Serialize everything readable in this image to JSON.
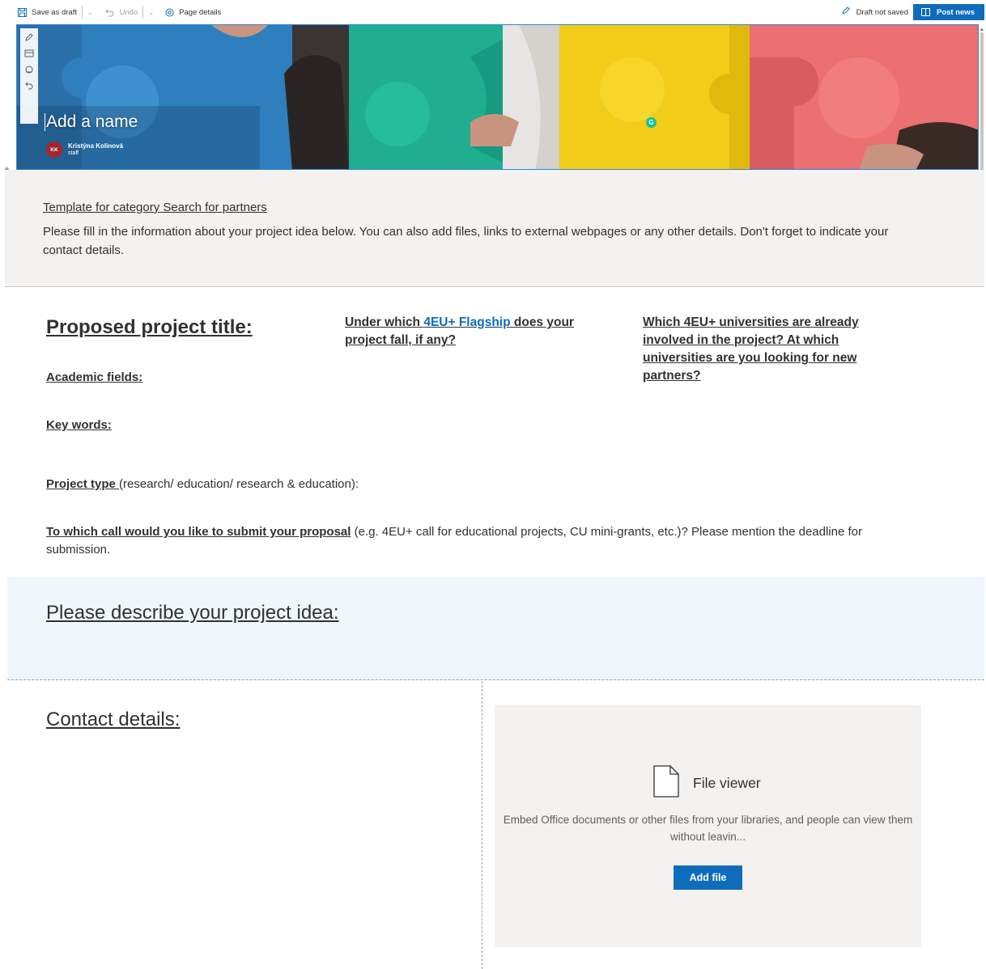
{
  "toolbar": {
    "save_draft": "Save as draft",
    "undo": "Undo",
    "page_details": "Page details",
    "draft_status": "Draft not saved",
    "post_news": "Post news"
  },
  "hero": {
    "title_placeholder": "Add a name",
    "author_initials": "KK",
    "author_name": "Kristýna Kolinová",
    "author_role": "staff",
    "grammarly_badge": "G"
  },
  "template": {
    "title": "Template for category Search for partners",
    "instructions": "Please fill in the information about your project idea below. You can also add files, links to external webpages or any other details. Don't forget to indicate your contact details."
  },
  "columns": {
    "col1_heading": "Proposed project title:",
    "academic_fields": "Academic fields:",
    "key_words": "Key words:",
    "col2_pre": "Under which ",
    "col2_link": "4EU+ Flagship",
    "col2_post": " does your project fall, if any?",
    "col3_heading": "Which 4EU+ universities are already involved in the project? At which universities are you looking for new partners?"
  },
  "project_type": {
    "label": "Project type ",
    "hint": "(research/ education/ research & education):"
  },
  "call": {
    "label": "To which call would you like to submit your proposal",
    "hint": " (e.g. 4EU+ call for educational projects, CU mini-grants, etc.)? Please mention the deadline for submission."
  },
  "describe": {
    "heading": "Please describe your project idea:"
  },
  "contact": {
    "heading": "Contact details:"
  },
  "file_viewer": {
    "title": "File viewer",
    "description": "Embed Office documents or other files from your libraries, and people can view them without leavin...",
    "button": "Add file"
  },
  "colors": {
    "accent": "#0f6cbd",
    "band_gray": "#f3f2f1",
    "band_blue": "#eff6fc",
    "avatar": "#a4262c"
  }
}
